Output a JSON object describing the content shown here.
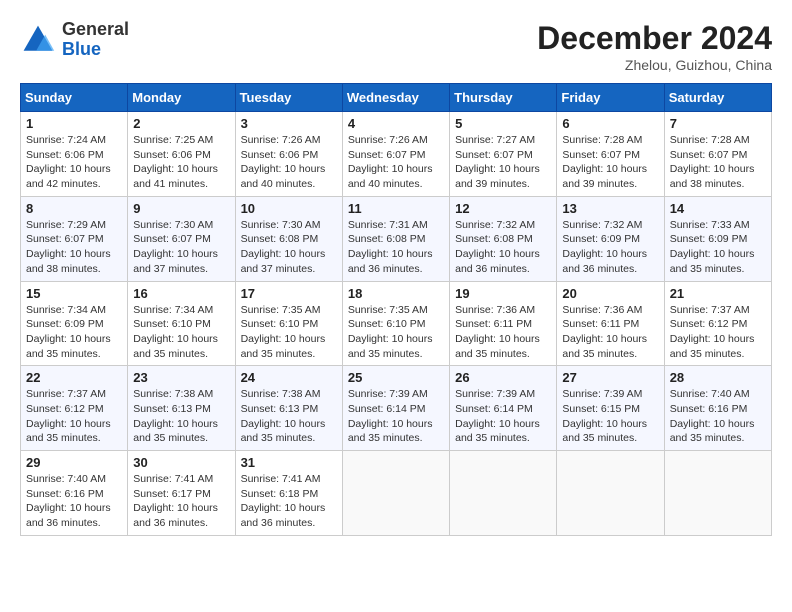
{
  "header": {
    "logo_general": "General",
    "logo_blue": "Blue",
    "month_title": "December 2024",
    "location": "Zhelou, Guizhou, China"
  },
  "weekdays": [
    "Sunday",
    "Monday",
    "Tuesday",
    "Wednesday",
    "Thursday",
    "Friday",
    "Saturday"
  ],
  "weeks": [
    [
      {
        "day": "1",
        "info": "Sunrise: 7:24 AM\nSunset: 6:06 PM\nDaylight: 10 hours and 42 minutes."
      },
      {
        "day": "2",
        "info": "Sunrise: 7:25 AM\nSunset: 6:06 PM\nDaylight: 10 hours and 41 minutes."
      },
      {
        "day": "3",
        "info": "Sunrise: 7:26 AM\nSunset: 6:06 PM\nDaylight: 10 hours and 40 minutes."
      },
      {
        "day": "4",
        "info": "Sunrise: 7:26 AM\nSunset: 6:07 PM\nDaylight: 10 hours and 40 minutes."
      },
      {
        "day": "5",
        "info": "Sunrise: 7:27 AM\nSunset: 6:07 PM\nDaylight: 10 hours and 39 minutes."
      },
      {
        "day": "6",
        "info": "Sunrise: 7:28 AM\nSunset: 6:07 PM\nDaylight: 10 hours and 39 minutes."
      },
      {
        "day": "7",
        "info": "Sunrise: 7:28 AM\nSunset: 6:07 PM\nDaylight: 10 hours and 38 minutes."
      }
    ],
    [
      {
        "day": "8",
        "info": "Sunrise: 7:29 AM\nSunset: 6:07 PM\nDaylight: 10 hours and 38 minutes."
      },
      {
        "day": "9",
        "info": "Sunrise: 7:30 AM\nSunset: 6:07 PM\nDaylight: 10 hours and 37 minutes."
      },
      {
        "day": "10",
        "info": "Sunrise: 7:30 AM\nSunset: 6:08 PM\nDaylight: 10 hours and 37 minutes."
      },
      {
        "day": "11",
        "info": "Sunrise: 7:31 AM\nSunset: 6:08 PM\nDaylight: 10 hours and 36 minutes."
      },
      {
        "day": "12",
        "info": "Sunrise: 7:32 AM\nSunset: 6:08 PM\nDaylight: 10 hours and 36 minutes."
      },
      {
        "day": "13",
        "info": "Sunrise: 7:32 AM\nSunset: 6:09 PM\nDaylight: 10 hours and 36 minutes."
      },
      {
        "day": "14",
        "info": "Sunrise: 7:33 AM\nSunset: 6:09 PM\nDaylight: 10 hours and 35 minutes."
      }
    ],
    [
      {
        "day": "15",
        "info": "Sunrise: 7:34 AM\nSunset: 6:09 PM\nDaylight: 10 hours and 35 minutes."
      },
      {
        "day": "16",
        "info": "Sunrise: 7:34 AM\nSunset: 6:10 PM\nDaylight: 10 hours and 35 minutes."
      },
      {
        "day": "17",
        "info": "Sunrise: 7:35 AM\nSunset: 6:10 PM\nDaylight: 10 hours and 35 minutes."
      },
      {
        "day": "18",
        "info": "Sunrise: 7:35 AM\nSunset: 6:10 PM\nDaylight: 10 hours and 35 minutes."
      },
      {
        "day": "19",
        "info": "Sunrise: 7:36 AM\nSunset: 6:11 PM\nDaylight: 10 hours and 35 minutes."
      },
      {
        "day": "20",
        "info": "Sunrise: 7:36 AM\nSunset: 6:11 PM\nDaylight: 10 hours and 35 minutes."
      },
      {
        "day": "21",
        "info": "Sunrise: 7:37 AM\nSunset: 6:12 PM\nDaylight: 10 hours and 35 minutes."
      }
    ],
    [
      {
        "day": "22",
        "info": "Sunrise: 7:37 AM\nSunset: 6:12 PM\nDaylight: 10 hours and 35 minutes."
      },
      {
        "day": "23",
        "info": "Sunrise: 7:38 AM\nSunset: 6:13 PM\nDaylight: 10 hours and 35 minutes."
      },
      {
        "day": "24",
        "info": "Sunrise: 7:38 AM\nSunset: 6:13 PM\nDaylight: 10 hours and 35 minutes."
      },
      {
        "day": "25",
        "info": "Sunrise: 7:39 AM\nSunset: 6:14 PM\nDaylight: 10 hours and 35 minutes."
      },
      {
        "day": "26",
        "info": "Sunrise: 7:39 AM\nSunset: 6:14 PM\nDaylight: 10 hours and 35 minutes."
      },
      {
        "day": "27",
        "info": "Sunrise: 7:39 AM\nSunset: 6:15 PM\nDaylight: 10 hours and 35 minutes."
      },
      {
        "day": "28",
        "info": "Sunrise: 7:40 AM\nSunset: 6:16 PM\nDaylight: 10 hours and 35 minutes."
      }
    ],
    [
      {
        "day": "29",
        "info": "Sunrise: 7:40 AM\nSunset: 6:16 PM\nDaylight: 10 hours and 36 minutes."
      },
      {
        "day": "30",
        "info": "Sunrise: 7:41 AM\nSunset: 6:17 PM\nDaylight: 10 hours and 36 minutes."
      },
      {
        "day": "31",
        "info": "Sunrise: 7:41 AM\nSunset: 6:18 PM\nDaylight: 10 hours and 36 minutes."
      },
      null,
      null,
      null,
      null
    ]
  ]
}
